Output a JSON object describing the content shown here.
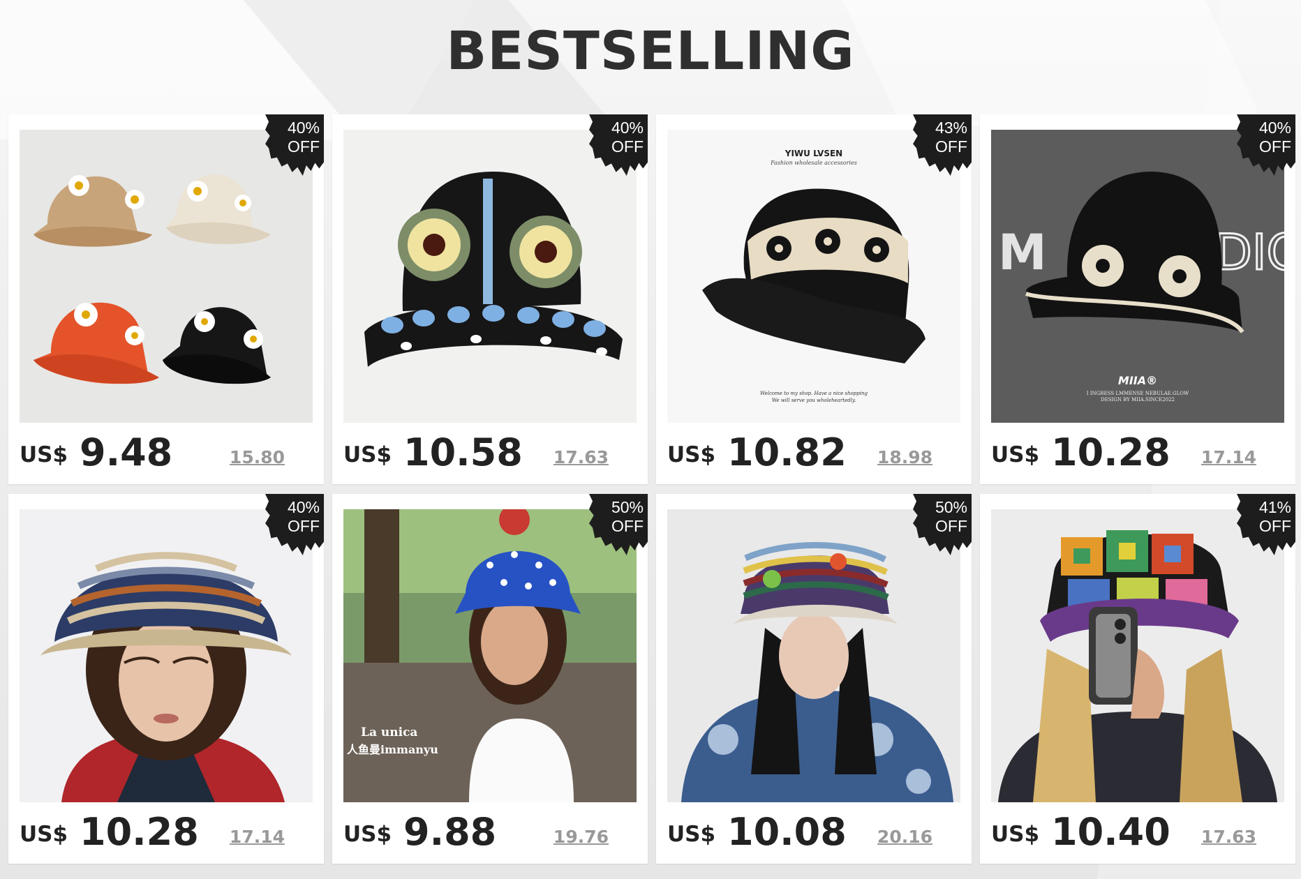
{
  "page": {
    "title": "BESTSELLING"
  },
  "products": [
    {
      "name": "Daisy crochet bucket hats set",
      "currency": "US$",
      "price": "9.48",
      "old_price": "15.80",
      "badge": {
        "pct": "40%",
        "off": "OFF"
      }
    },
    {
      "name": "Sunflower crochet bucket hat",
      "currency": "US$",
      "price": "10.58",
      "old_price": "17.63",
      "badge": {
        "pct": "40%",
        "off": "OFF"
      },
      "image_text": []
    },
    {
      "name": "Granny square black bucket hat",
      "currency": "US$",
      "price": "10.82",
      "old_price": "18.98",
      "badge": {
        "pct": "43%",
        "off": "OFF"
      },
      "image_text": [
        "YIWU LVSEN",
        "Fashion wholesale accessories",
        "Welcome to my shop. Have a nice shopping",
        "We will serve you wholeheartedly."
      ]
    },
    {
      "name": "Black flower crochet hat",
      "currency": "US$",
      "price": "10.28",
      "old_price": "17.14",
      "badge": {
        "pct": "40%",
        "off": "OFF"
      },
      "image_text": [
        "MIIA®",
        "I INGRESS LMMENSE NEBULAE.GLOW",
        "DESIGN BY MIIA.SINCE2022"
      ]
    },
    {
      "name": "Striped knit bucket hat",
      "currency": "US$",
      "price": "10.28",
      "old_price": "17.14",
      "badge": {
        "pct": "40%",
        "off": "OFF"
      }
    },
    {
      "name": "Blue star crochet bucket hat",
      "currency": "US$",
      "price": "9.88",
      "old_price": "19.76",
      "badge": {
        "pct": "50%",
        "off": "OFF"
      },
      "image_text": [
        "La unica",
        "人鱼曼immanyu"
      ]
    },
    {
      "name": "Rainbow stripe flower bucket hat",
      "currency": "US$",
      "price": "10.08",
      "old_price": "20.16",
      "badge": {
        "pct": "50%",
        "off": "OFF"
      }
    },
    {
      "name": "Multicolor granny square hat",
      "currency": "US$",
      "price": "10.40",
      "old_price": "17.63",
      "badge": {
        "pct": "41%",
        "off": "OFF"
      }
    }
  ],
  "colors": {
    "title": "#2f2f2f",
    "badge_bg": "#1d1d1d",
    "price": "#222222",
    "old_price": "#999999"
  }
}
